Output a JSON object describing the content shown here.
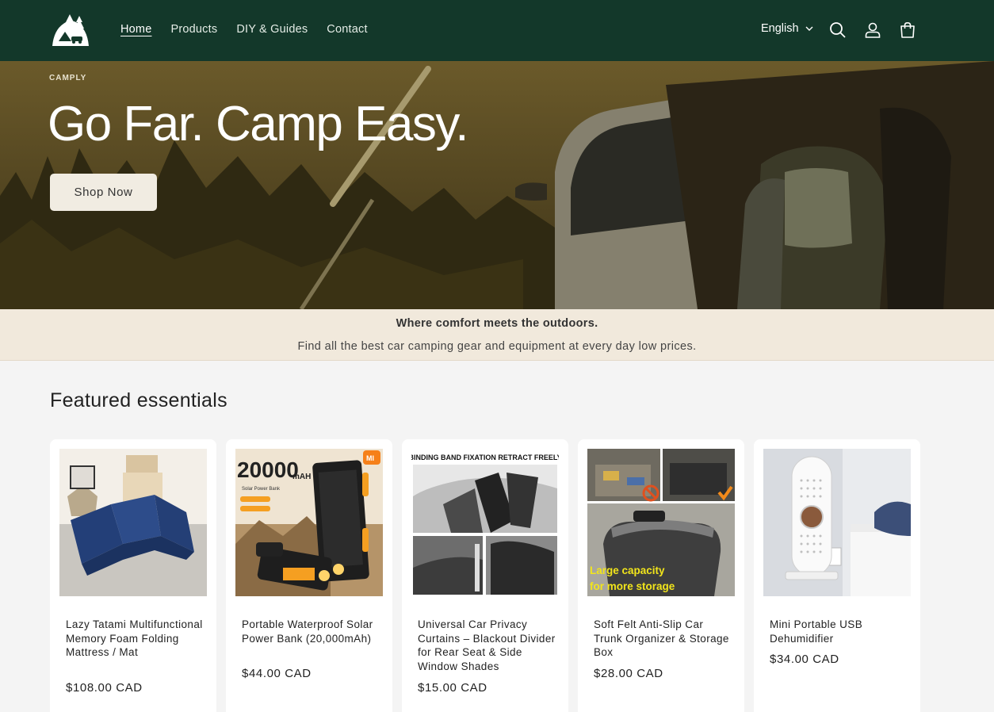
{
  "header": {
    "nav": [
      "Home",
      "Products",
      "DIY & Guides",
      "Contact"
    ],
    "language": "English"
  },
  "hero": {
    "label": "CAMPLY",
    "title": "Go Far. Camp Easy.",
    "button": "Shop Now"
  },
  "banner": {
    "title": "Where comfort meets the outdoors.",
    "subtitle": "Find all the best car camping gear and equipment at every day low prices."
  },
  "featured": {
    "title": "Featured essentials",
    "products": [
      {
        "name": "Lazy Tatami Multifunctional Memory Foam Folding Mattress / Mat",
        "price": "$108.00 CAD"
      },
      {
        "name": "Portable Waterproof Solar Power Bank (20,000mAh)",
        "price": "$44.00 CAD",
        "image_text": {
          "big": "20000",
          "unit": "mAH",
          "caption": "Solar Power Bank",
          "brand": "MI"
        }
      },
      {
        "name": "Universal Car Privacy Curtains – Blackout Divider for Rear Seat & Side Window Shades",
        "price": "$15.00 CAD",
        "image_text": {
          "banner": "BINDING BAND FIXATION RETRACT FREELY"
        }
      },
      {
        "name": "Soft Felt Anti-Slip Car Trunk Organizer & Storage Box",
        "price": "$28.00 CAD",
        "image_text": {
          "line1": "Large capacity",
          "line2": "for more storage"
        }
      },
      {
        "name": "Mini Portable USB Dehumidifier",
        "price": "$34.00 CAD"
      }
    ]
  },
  "colors": {
    "header_bg": "#13382a",
    "banner_bg": "#f1e9dc",
    "button_bg": "#f1ece2"
  },
  "icons": [
    "logo-icon",
    "search-icon",
    "account-icon",
    "cart-icon",
    "chevron-down-icon"
  ]
}
